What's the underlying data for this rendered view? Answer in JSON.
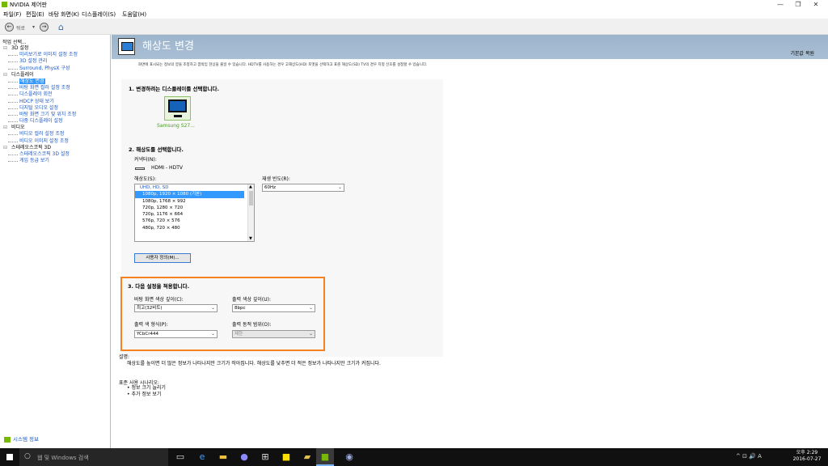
{
  "window": {
    "title": "NVIDIA 제어판",
    "minimize": "—",
    "maximize": "❐",
    "close": "✕"
  },
  "menu": [
    "파일(F)",
    "편집(E)",
    "바탕 화면(K)",
    "디스플레이(S)",
    "도움말(H)"
  ],
  "toolbar": {
    "back_label": "뒤로",
    "back_arrow": "←",
    "forward_arrow": "→",
    "dropdown": "▾",
    "home": "⌂"
  },
  "sidebar": {
    "task_label": "작업 선택...",
    "tree": [
      {
        "label": "3D 설정",
        "type": "cat"
      },
      {
        "label": "미리보기로 이미지 설정 조정",
        "type": "sub"
      },
      {
        "label": "3D 설정 관리",
        "type": "sub"
      },
      {
        "label": "Surround, PhysX 구성",
        "type": "sub"
      },
      {
        "label": "디스플레이",
        "type": "cat"
      },
      {
        "label": "해상도 변경",
        "type": "sub",
        "selected": true
      },
      {
        "label": "바탕 화면 컬러 설정 조정",
        "type": "sub"
      },
      {
        "label": "디스플레이 회전",
        "type": "sub"
      },
      {
        "label": "HDCP 상태 보기",
        "type": "sub"
      },
      {
        "label": "디지털 오디오 설정",
        "type": "sub"
      },
      {
        "label": "바탕 화면 크기 및 위치 조정",
        "type": "sub"
      },
      {
        "label": "다중 디스플레이 설정",
        "type": "sub"
      },
      {
        "label": "비디오",
        "type": "cat"
      },
      {
        "label": "비디오 컬러 설정 조정",
        "type": "sub"
      },
      {
        "label": "비디오 이미지 설정 조정",
        "type": "sub"
      },
      {
        "label": "스테레오스코픽 3D",
        "type": "cat"
      },
      {
        "label": "스테레오스코픽 3D 설정",
        "type": "sub"
      },
      {
        "label": "게임 등급 보기",
        "type": "sub"
      }
    ],
    "system_info": "시스템 정보"
  },
  "main": {
    "title": "해상도 변경",
    "restore": "기본값 복원",
    "description": "화면에 표시되는 정보의 양을 조정하고 깜박임 현상을 줄일 수 있습니다. HDTV를 사용하는 경우 고해상도(HD) 포맷을 선택하고 표준 해상도(SD) TV의 경우 지정 신호를 설정할 수 있습니다.",
    "sec1": "1. 변경하려는 디스플레이를 선택합니다.",
    "monitor_label": "Samsung S27...",
    "sec2": "2. 해상도를 선택합니다.",
    "connector_label": "커넥터(N):",
    "connector_value": "HDMI - HDTV",
    "resolution_label": "해상도(S):",
    "resolution_group": "UHD, HD, SD",
    "resolutions": [
      "1080p, 1920 × 1080 (기본)",
      "1080p, 1768 × 992",
      "720p, 1280 × 720",
      "720p, 1176 × 664",
      "576p, 720 × 576",
      "480p, 720 × 480"
    ],
    "refresh_label": "재생 빈도(R):",
    "refresh_value": "60Hz",
    "custom_button": "사용자 정의(M)...",
    "sec3": "3. 다음 설정을 적용합니다.",
    "desktop_color_label": "바탕 화면 색상 깊이(C):",
    "desktop_color_value": "최고(32비트)",
    "output_depth_label": "출력 색상 깊이(U):",
    "output_depth_value": "8bpc",
    "output_format_label": "출력 색 형식(P):",
    "output_format_value": "YCbCr444",
    "output_range_label": "출력 동적 범위(O):",
    "output_range_value": "제한",
    "explain_label": "설명:",
    "explain_text": "해상도를 높이면 더 많은 정보가 나타나지만 크기가 작아집니다. 해상도를 낮추면 더 적은 정보가 나타나지만 크기가 커집니다.",
    "scenario_label": "표준 사용 시나리오:",
    "scenarios": [
      "• 정보 크기 늘리기",
      "• 추가 정보 보기"
    ]
  },
  "taskbar": {
    "search_placeholder": "웹 및 Windows 검색",
    "tray_text": "^ ⊡ 🔊 A",
    "time": "오후 2:29",
    "date": "2016-07-27"
  }
}
